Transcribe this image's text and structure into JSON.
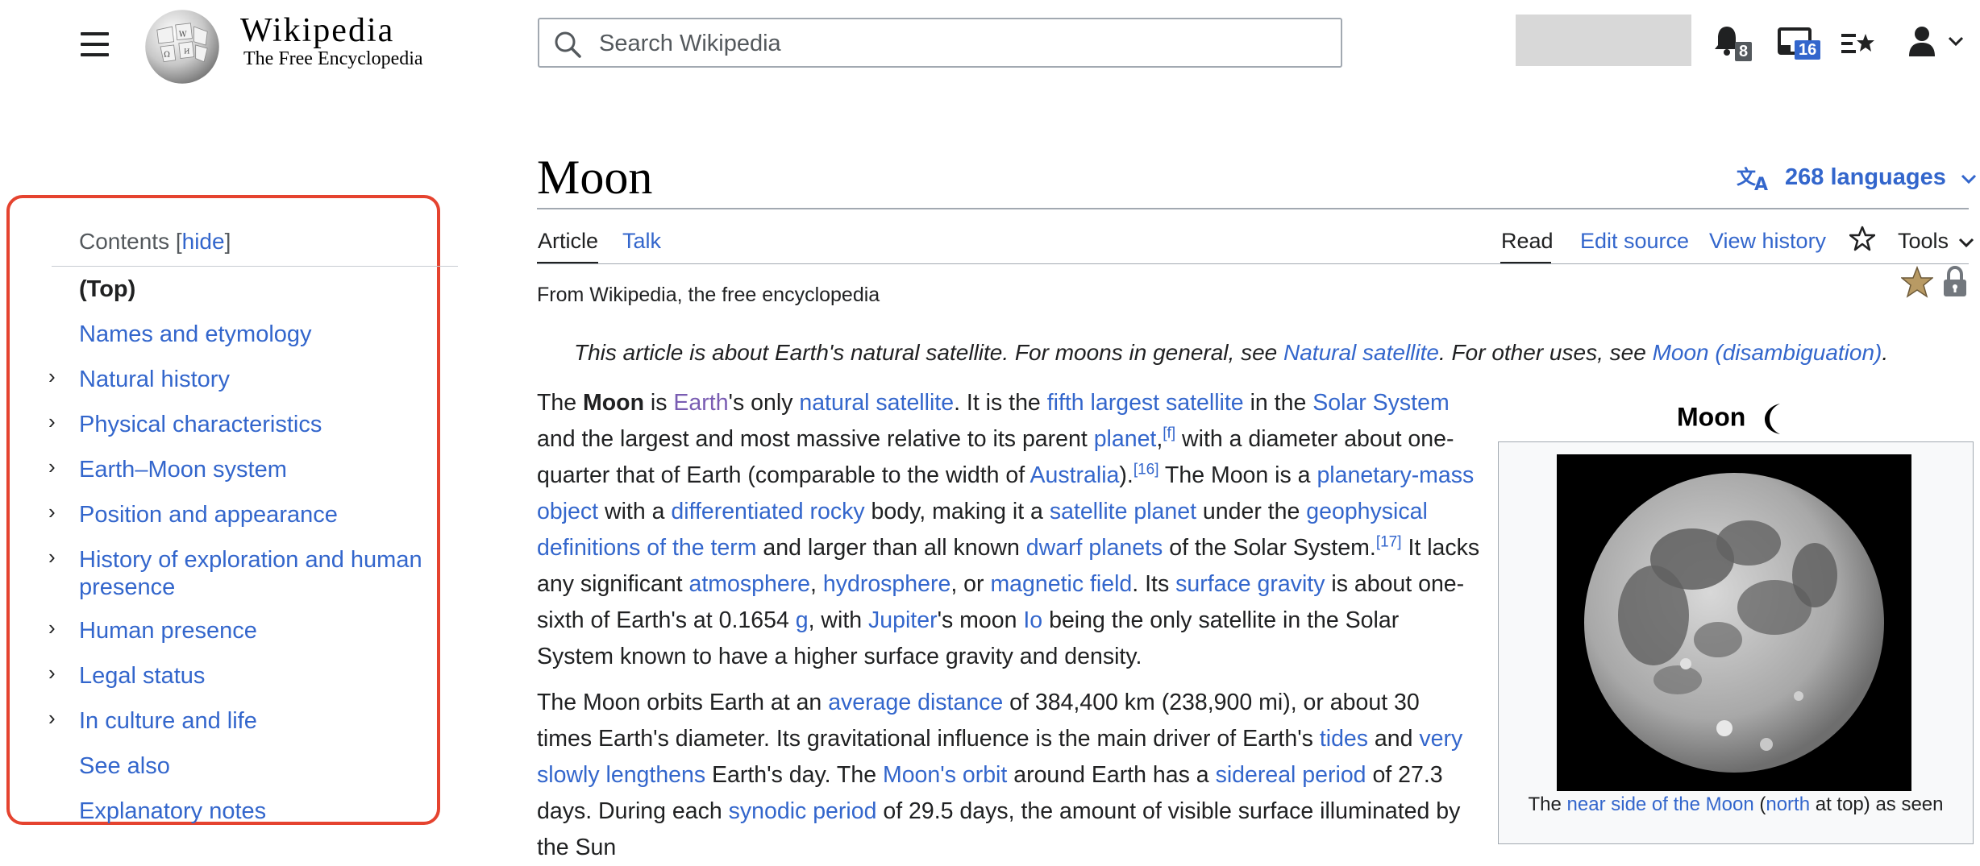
{
  "header": {
    "wordmark": "Wikipedia",
    "tagline": "The Free Encyclopedia",
    "search_placeholder": "Search Wikipedia",
    "notifications_badge": "8",
    "notices_badge": "16"
  },
  "toc": {
    "title": "Contents",
    "hide_label": "hide",
    "items": [
      {
        "label": "(Top)"
      },
      {
        "label": "Names and etymology"
      },
      {
        "label": "Natural history"
      },
      {
        "label": "Physical characteristics"
      },
      {
        "label": "Earth–Moon system"
      },
      {
        "label": "Position and appearance"
      },
      {
        "label": "History of exploration and human presence"
      },
      {
        "label": "Human presence"
      },
      {
        "label": "Legal status"
      },
      {
        "label": "In culture and life"
      },
      {
        "label": "See also"
      },
      {
        "label": "Explanatory notes"
      }
    ]
  },
  "article": {
    "title": "Moon",
    "languages_label": "268 languages",
    "tabs": {
      "article": "Article",
      "talk": "Talk",
      "read": "Read",
      "edit_source": "Edit source",
      "view_history": "View history",
      "tools": "Tools"
    },
    "from": "From Wikipedia, the free encyclopedia",
    "hatnote": {
      "p1": "This article is about Earth's natural satellite. For moons in general, see ",
      "l1": "Natural satellite",
      "p2": ". For other uses, see ",
      "l2": "Moon (disambiguation)",
      "p3": "."
    },
    "para1": {
      "t1": "The ",
      "b1": "Moon",
      "t2": " is ",
      "v1": "Earth",
      "t3": "'s only ",
      "l1": "natural satellite",
      "t4": ". It is the ",
      "l2": "fifth largest satellite",
      "t5": " in the ",
      "l3": "Solar System",
      "t6": " and the largest and most massive relative to its parent ",
      "l4": "planet",
      "t7": ",",
      "s1": "[f]",
      "t8": " with a diameter about one-quarter that of Earth (comparable to the width of ",
      "l5": "Australia",
      "t9": ").",
      "s2": "[16]",
      "t10": " The Moon is a ",
      "l6": "planetary-mass object",
      "t11": " with a ",
      "l7": "differentiated rocky",
      "t12": " body, making it a ",
      "l8": "satellite planet",
      "t13": " under the ",
      "l9": "geophysical definitions of the term",
      "t14": " and larger than all known ",
      "l10": "dwarf planets",
      "t15": " of the Solar System.",
      "s3": "[17]",
      "t16": " It lacks any significant ",
      "l11": "atmosphere",
      "t17": ", ",
      "l12": "hydrosphere",
      "t18": ", or ",
      "l13": "magnetic field",
      "t19": ". Its ",
      "l14": "surface gravity",
      "t20": " is about one-sixth of Earth's at 0.1654 ",
      "l15": "g",
      "t21": ", with ",
      "l16": "Jupiter",
      "t22": "'s moon ",
      "l17": "Io",
      "t23": " being the only satellite in the Solar System known to have a higher surface gravity and density."
    },
    "para2": {
      "t1": "The Moon orbits Earth at an ",
      "l1": "average distance",
      "t2": " of 384,400 km (238,900 mi), or about 30 times Earth's diameter. Its gravitational influence is the main driver of Earth's ",
      "l2": "tides",
      "t3": " and ",
      "l3": "very slowly lengthens",
      "t4": " Earth's day. The ",
      "l4": "Moon's orbit",
      "t5": " around Earth has a ",
      "l5": "sidereal period",
      "t6": " of 27.3 days. During each ",
      "l6": "synodic period",
      "t7": " of 29.5 days, the amount of visible surface illuminated by the Sun"
    }
  },
  "infobox": {
    "title": "Moon",
    "caption": {
      "t1": "The ",
      "l1": "near side of the Moon",
      "t2": " (",
      "l2": "north",
      "t3": " at top) as seen"
    }
  }
}
